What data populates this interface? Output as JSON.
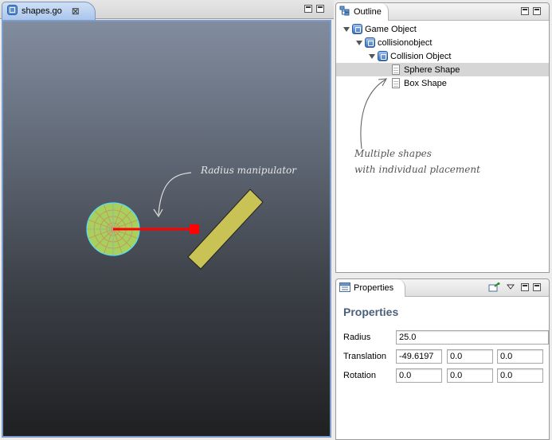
{
  "editor": {
    "tab_label": "shapes.go",
    "tab_icon": "game-object-file-icon"
  },
  "scene": {
    "annotation": "Radius manipulator",
    "colors": {
      "sphere_fill": "#a8d05c",
      "sphere_grid": "#c98a66",
      "sphere_outline": "#4fe0ff",
      "manipulator": "#ff0000",
      "box_fill": "#c9c255",
      "box_outline": "#222222"
    }
  },
  "outline": {
    "tab_label": "Outline",
    "tree": [
      {
        "label": "Game Object",
        "icon": "game-object-icon",
        "expanded": true
      },
      {
        "label": "collisionobject",
        "icon": "component-icon",
        "expanded": true
      },
      {
        "label": "Collision Object",
        "icon": "component-icon",
        "expanded": true
      },
      {
        "label": "Sphere Shape",
        "icon": "shape-page-icon",
        "selected": true
      },
      {
        "label": "Box Shape",
        "icon": "shape-page-icon"
      }
    ],
    "annotation_line1": "Multiple shapes",
    "annotation_line2": "with individual placement"
  },
  "properties": {
    "tab_label": "Properties",
    "title": "Properties",
    "radius_label": "Radius",
    "radius_value": "25.0",
    "translation_label": "Translation",
    "translation": [
      "-49.6197",
      "0.0",
      "0.0"
    ],
    "rotation_label": "Rotation",
    "rotation": [
      "0.0",
      "0.0",
      "0.0"
    ]
  }
}
